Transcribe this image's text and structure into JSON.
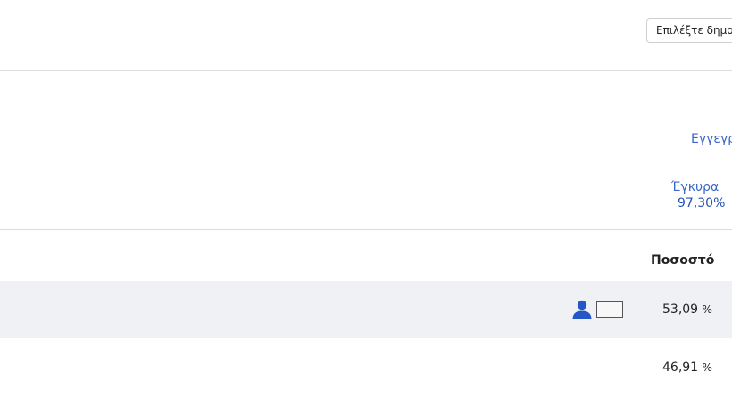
{
  "municipality_select": {
    "value": "Επιλέξτε δημο"
  },
  "stats": {
    "registered_label": "Εγγεγρ",
    "valid_label": "Έγκυρα",
    "valid_value": "97,30%"
  },
  "results_table": {
    "percent_header": "Ποσοστό",
    "rows": [
      {
        "percent": "53,09",
        "unit": "%",
        "has_icons": true
      },
      {
        "percent": "46,91",
        "unit": "%",
        "has_icons": false
      }
    ]
  },
  "colors": {
    "link_blue": "#3a66c8",
    "value_blue": "#2450b8",
    "icon_blue": "#2457c5",
    "row_shade": "#eff1f4",
    "divider": "#dcdcdc"
  },
  "icons": [
    "person-icon",
    "blank-box"
  ]
}
